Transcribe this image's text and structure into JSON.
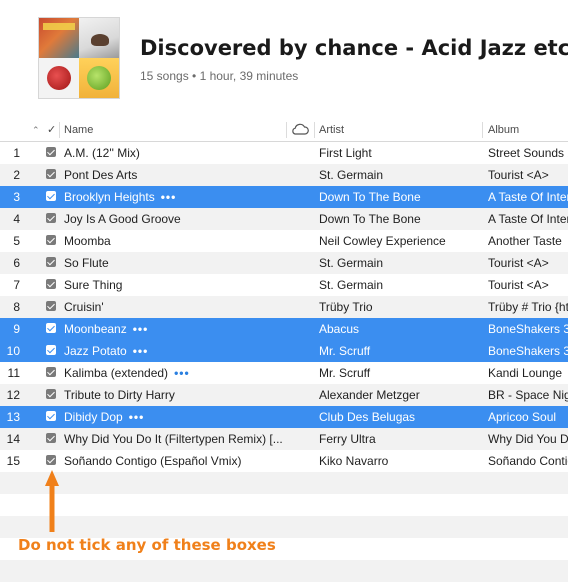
{
  "playlist": {
    "title": "Discovered by chance - Acid Jazz etc",
    "subtitle": "15 songs • 1 hour, 39 minutes"
  },
  "columns": {
    "check": "✓",
    "name": "Name",
    "cloud_icon": "cloud-icon",
    "artist": "Artist",
    "album": "Album"
  },
  "colors": {
    "selection": "#3b8ef0",
    "annotation": "#f0801a",
    "stripe": "#f2f2f2"
  },
  "tracks": [
    {
      "num": "1",
      "name": "A.M. (12'' Mix)",
      "artist": "First Light",
      "album": "Street Sounds 2",
      "selected": false,
      "more": ""
    },
    {
      "num": "2",
      "name": "Pont Des Arts",
      "artist": "St. Germain",
      "album": "Tourist  <A>",
      "selected": false,
      "more": ""
    },
    {
      "num": "3",
      "name": "Brooklyn Heights",
      "artist": "Down To The Bone",
      "album": "A Taste Of Intern",
      "selected": true,
      "more": "•••"
    },
    {
      "num": "4",
      "name": "Joy Is A Good Groove",
      "artist": "Down To The Bone",
      "album": "A Taste Of Intern",
      "selected": false,
      "more": ""
    },
    {
      "num": "5",
      "name": "Moomba",
      "artist": "Neil Cowley Experience",
      "album": "Another Taste",
      "selected": false,
      "more": ""
    },
    {
      "num": "6",
      "name": "So Flute",
      "artist": "St. Germain",
      "album": "Tourist  <A>",
      "selected": false,
      "more": ""
    },
    {
      "num": "7",
      "name": "Sure Thing",
      "artist": "St. Germain",
      "album": "Tourist  <A>",
      "selected": false,
      "more": ""
    },
    {
      "num": "8",
      "name": "Cruisin'",
      "artist": "Trüby Trio",
      "album": "Trüby # Trio {htt",
      "selected": false,
      "more": ""
    },
    {
      "num": "9",
      "name": "Moonbeanz",
      "artist": "Abacus",
      "album": "BoneShakers 3",
      "selected": true,
      "more": "•••"
    },
    {
      "num": "10",
      "name": "Jazz Potato",
      "artist": "Mr. Scruff",
      "album": "BoneShakers 3",
      "selected": true,
      "more": "•••"
    },
    {
      "num": "11",
      "name": "Kalimba (extended)",
      "artist": "Mr. Scruff",
      "album": "Kandi Lounge",
      "selected": false,
      "more": "•••"
    },
    {
      "num": "12",
      "name": "Tribute to Dirty Harry",
      "artist": "Alexander Metzger",
      "album": "BR - Space Nigh",
      "selected": false,
      "more": ""
    },
    {
      "num": "13",
      "name": "Dibidy Dop",
      "artist": "Club Des Belugas",
      "album": "Apricoo Soul",
      "selected": true,
      "more": "•••"
    },
    {
      "num": "14",
      "name": "Why Did You Do It (Filtertypen Remix) [...",
      "artist": "Ferry Ultra",
      "album": "Why Did You Do",
      "selected": false,
      "more": ""
    },
    {
      "num": "15",
      "name": "Soñando Contigo (Español Vmix)",
      "artist": "Kiko Navarro",
      "album": "Soñando Contigo",
      "selected": false,
      "more": ""
    }
  ],
  "annotation": {
    "text": "Do not tick any of these boxes"
  }
}
